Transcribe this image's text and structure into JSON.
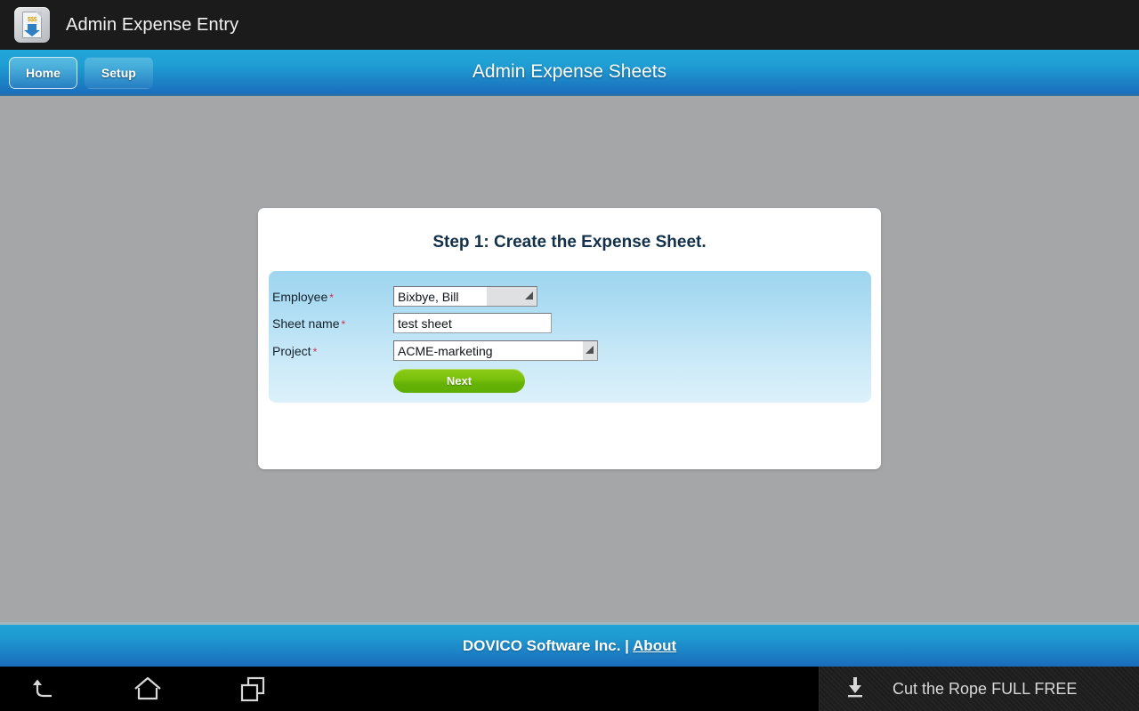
{
  "android": {
    "app_title": "Admin Expense Entry",
    "app_icon": "expense-document-icon",
    "icon_money_text": "$$$",
    "nav": {
      "back": "back-icon",
      "home": "home-icon",
      "recents": "recent-apps-icon"
    },
    "notification": {
      "icon": "download-icon",
      "text": "Cut the Rope FULL FREE"
    }
  },
  "header": {
    "title": "Admin Expense Sheets",
    "tabs": [
      {
        "label": "Home",
        "active": true
      },
      {
        "label": "Setup",
        "active": false
      }
    ]
  },
  "card": {
    "title": "Step 1: Create the Expense Sheet.",
    "required_marker": "*",
    "fields": [
      {
        "label": "Employee",
        "type": "select",
        "value": "Bixbye, Bill",
        "required": true,
        "arrow": "dropdown-arrow-icon"
      },
      {
        "label": "Sheet name",
        "type": "text",
        "value": "test sheet",
        "placeholder": "",
        "required": true
      },
      {
        "label": "Project",
        "type": "select",
        "value": "ACME-marketing",
        "required": true,
        "arrow": "dropdown-arrow-icon"
      }
    ],
    "next_label": "Next"
  },
  "footer": {
    "company": "DOVICO Software Inc. |",
    "link": "About"
  },
  "colors": {
    "page_background": "#a4a6a8",
    "header_blue_top": "#21a6d8",
    "header_blue_bottom": "#1a6ebc",
    "panel_blue_top": "#9ed5ef",
    "panel_blue_bottom": "#dcf1fb",
    "next_green": "#79c00c",
    "required_red": "#d62f4a",
    "card_title": "#12304a",
    "titlebar_black": "#1b1b1b"
  }
}
